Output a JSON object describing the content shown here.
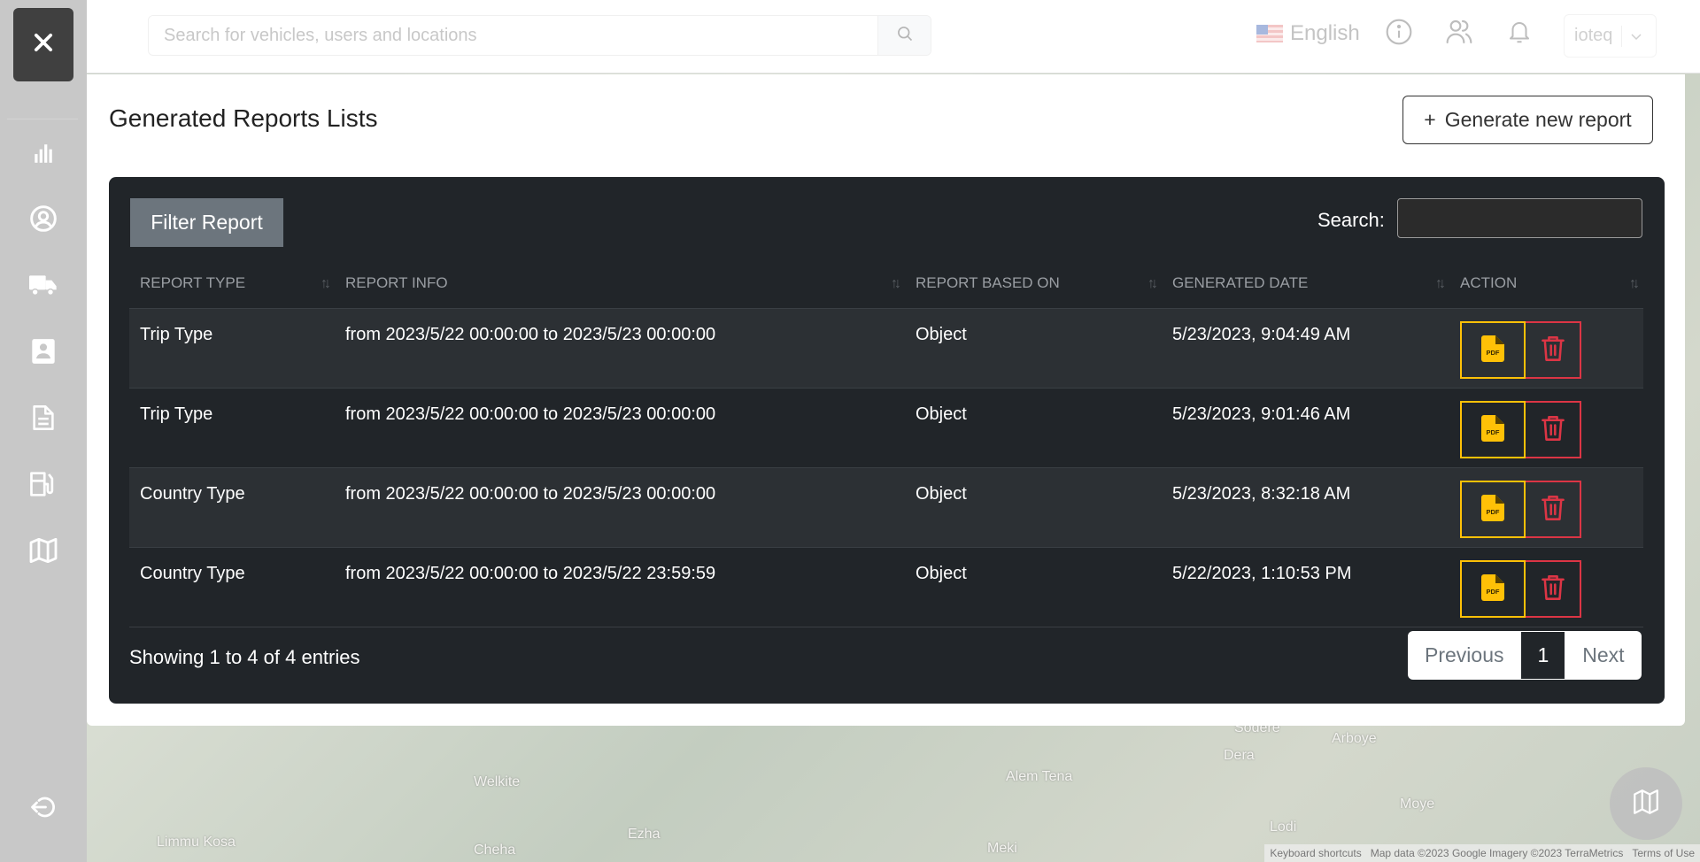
{
  "sidebar": {
    "close_icon": "close-icon",
    "items": [
      {
        "name": "dashboard",
        "icon": "bar-chart-icon"
      },
      {
        "name": "users",
        "icon": "user-circle-icon"
      },
      {
        "name": "vehicles",
        "icon": "truck-icon"
      },
      {
        "name": "drivers",
        "icon": "contact-card-icon"
      },
      {
        "name": "reports",
        "icon": "document-icon"
      },
      {
        "name": "fuel",
        "icon": "fuel-pump-icon"
      },
      {
        "name": "map",
        "icon": "map-icon"
      }
    ],
    "logout_icon": "logout-icon"
  },
  "topbar": {
    "search_placeholder": "Search for vehicles, users and locations",
    "search_value": "",
    "language": "English",
    "user": "ioteq"
  },
  "page": {
    "title": "Generated Reports Lists",
    "generate_button": "Generate new report",
    "filter_button": "Filter Report",
    "search_label": "Search:",
    "search_value": ""
  },
  "table": {
    "columns": [
      "REPORT TYPE",
      "REPORT INFO",
      "REPORT BASED ON",
      "GENERATED DATE",
      "ACTION"
    ],
    "rows": [
      {
        "type": "Trip Type",
        "info": "from 2023/5/22 00:00:00 to 2023/5/23 00:00:00",
        "based_on": "Object",
        "date": "5/23/2023, 9:04:49 AM"
      },
      {
        "type": "Trip Type",
        "info": "from 2023/5/22 00:00:00 to 2023/5/23 00:00:00",
        "based_on": "Object",
        "date": "5/23/2023, 9:01:46 AM"
      },
      {
        "type": "Country Type",
        "info": "from 2023/5/22 00:00:00 to 2023/5/23 00:00:00",
        "based_on": "Object",
        "date": "5/23/2023, 8:32:18 AM"
      },
      {
        "type": "Country Type",
        "info": "from 2023/5/22 00:00:00 to 2023/5/22 23:59:59",
        "based_on": "Object",
        "date": "5/22/2023, 1:10:53 PM"
      }
    ],
    "pdf_label": "PDF"
  },
  "footer": {
    "info": "Showing 1 to 4 of 4 entries",
    "previous": "Previous",
    "current_page": "1",
    "next": "Next"
  },
  "map": {
    "labels": [
      "Welkite",
      "Limmu Kosa",
      "Cheha",
      "Ezha",
      "Alem Tena",
      "Meki",
      "Sodere",
      "Dera",
      "Arboye",
      "Lodi",
      "Moye"
    ],
    "attribution": {
      "shortcuts": "Keyboard shortcuts",
      "data": "Map data ©2023 Google Imagery ©2023 TerraMetrics",
      "terms": "Terms of Use"
    }
  },
  "colors": {
    "sidebar_bg": "#c8c8c8",
    "card_bg": "#212529",
    "filter_btn": "#6c757d",
    "pdf_accent": "#ffc107",
    "delete_accent": "#dc3545"
  }
}
